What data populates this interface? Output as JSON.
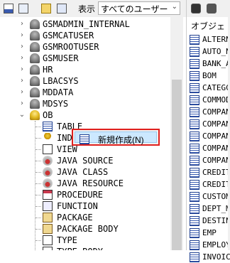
{
  "toolbar": {
    "icons": [
      "object-browser-icon",
      "refresh-icon",
      "filter-icon",
      "schema-icon"
    ],
    "display_label": "表示",
    "user_filter_value": "すべてのユーザー"
  },
  "tree": {
    "users": [
      {
        "label": "GSMADMIN_INTERNAL",
        "expanded": false
      },
      {
        "label": "GSMCATUSER",
        "expanded": false
      },
      {
        "label": "GSMROOTUSER",
        "expanded": false
      },
      {
        "label": "GSMUSER",
        "expanded": false
      },
      {
        "label": "HR",
        "expanded": false
      },
      {
        "label": "LBACSYS",
        "expanded": false
      },
      {
        "label": "MDDATA",
        "expanded": false
      },
      {
        "label": "MDSYS",
        "expanded": false
      },
      {
        "label": "OB",
        "expanded": true
      }
    ],
    "ob_children": [
      {
        "label": "TABLE",
        "icon": "table-icon"
      },
      {
        "label": "INDEX",
        "icon": "index-icon"
      },
      {
        "label": "VIEW",
        "icon": "view-icon"
      },
      {
        "label": "JAVA SOURCE",
        "icon": "java-source-icon"
      },
      {
        "label": "JAVA CLASS",
        "icon": "java-class-icon"
      },
      {
        "label": "JAVA RESOURCE",
        "icon": "java-resource-icon"
      },
      {
        "label": "PROCEDURE",
        "icon": "procedure-icon"
      },
      {
        "label": "FUNCTION",
        "icon": "function-icon"
      },
      {
        "label": "PACKAGE",
        "icon": "package-icon"
      },
      {
        "label": "PACKAGE BODY",
        "icon": "package-body-icon"
      },
      {
        "label": "TYPE",
        "icon": "type-icon"
      },
      {
        "label": "TYPE BODY",
        "icon": "type-body-icon"
      }
    ]
  },
  "context_menu": {
    "items": [
      {
        "label": "新規作成(N)",
        "icon": "new-table-icon"
      }
    ]
  },
  "right_panel": {
    "toolbar_icons": [
      "binoculars-icon",
      "find-next-icon"
    ],
    "header": "オブジェ",
    "items": [
      "ALTERN",
      "AUTO_N",
      "BANK_A",
      "BOM",
      "CATEGC",
      "COMMOD",
      "COMPAN",
      "COMPAN",
      "COMPAN",
      "COMPAN",
      "COMPAN",
      "CREDIT",
      "CREDIT",
      "CUSTOM",
      "DEPT_M",
      "DESTIN",
      "EMP",
      "EMPLOY",
      "INVOIC"
    ]
  },
  "colors": {
    "highlight_border": "#e0201e",
    "menu_selection": "#cce8ff",
    "toolbar_bg": "#f0f0f0"
  }
}
